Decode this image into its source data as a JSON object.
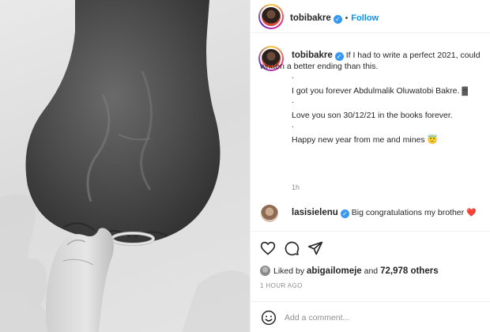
{
  "post": {
    "author": "tobibakre",
    "follow_label": "Follow",
    "dot": "•",
    "caption": {
      "line1": "If I had to write a perfect 2021, could",
      "line2": "written a better ending than this.",
      "sep1": ".",
      "line3": "I got you forever Abdulmalik Oluwatobi Bakre. ▓",
      "sep2": ".",
      "line4": "Love you son 30/12/21 in the books forever.",
      "sep3": ".",
      "line5": "Happy new year from me and mines 😇"
    },
    "caption_time": "1h"
  },
  "comment": {
    "user": "lasisielenu",
    "text": "Big congratulations my brother",
    "heart": "❤️"
  },
  "likes": {
    "prefix": "Liked by",
    "user": "abigailomeje",
    "joiner": "and",
    "others": "72,978 others"
  },
  "posted_ago": "1 HOUR AGO",
  "add_comment": {
    "placeholder": "Add a comment..."
  },
  "icons": [
    "verified-badge-icon",
    "heart-icon",
    "comment-icon",
    "share-icon",
    "emoji-icon"
  ],
  "colors": {
    "follow_blue": "#0095f6",
    "verified_blue": "#3897f0",
    "meta_gray": "#8e8e8e",
    "heart_red": "#ed4956"
  }
}
